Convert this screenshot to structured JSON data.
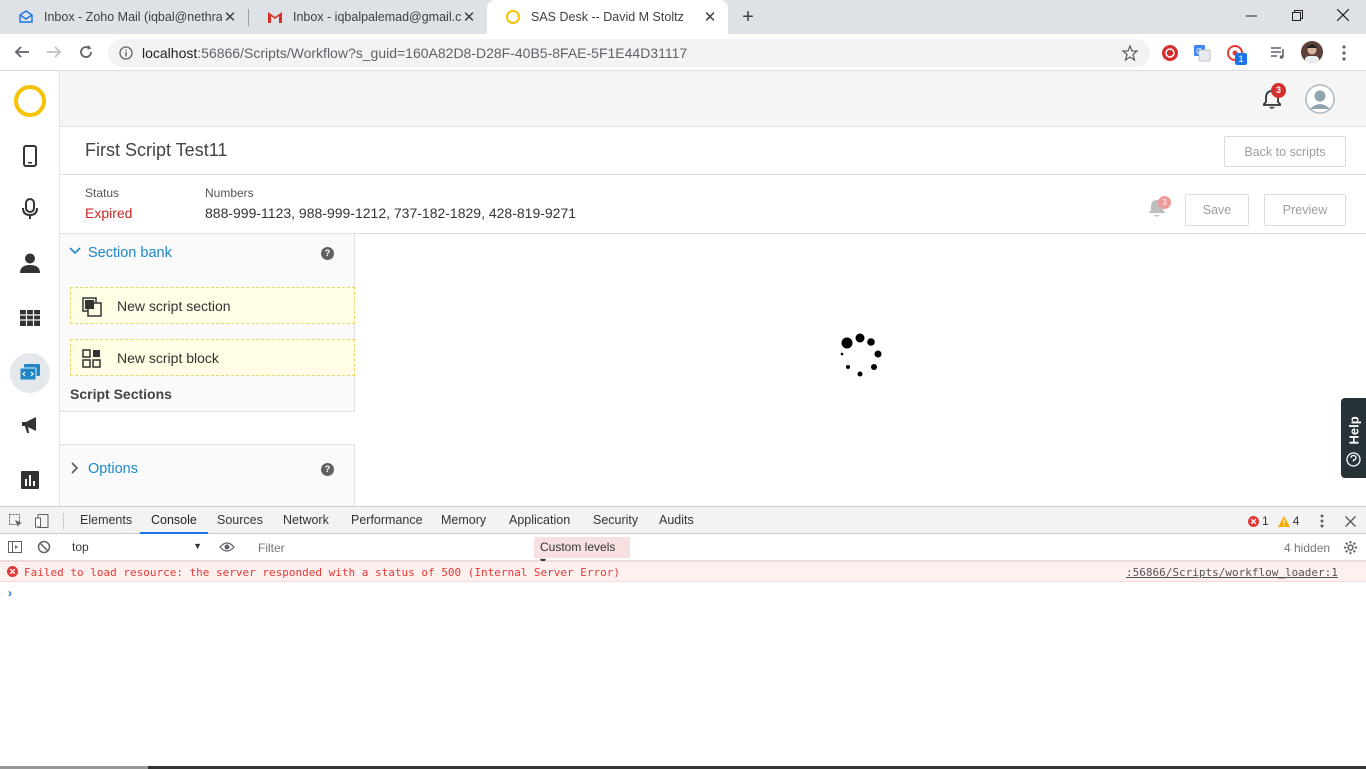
{
  "browser": {
    "tabs": [
      {
        "title": "Inbox - Zoho Mail (iqbal@nethra",
        "icon": "zoho-mail-icon"
      },
      {
        "title": "Inbox - iqbalpalemad@gmail.com",
        "icon": "gmail-icon"
      },
      {
        "title": "SAS Desk -- David M Stoltz",
        "icon": "sas-desk-icon",
        "active": true
      }
    ],
    "url_host": "localhost",
    "url_path": ":56866/Scripts/Workflow?s_guid=160A82D8-D28F-40B5-8FAE-5F1E44D31117",
    "extension_badge": "1"
  },
  "app": {
    "notification_count": "3",
    "page_title": "First Script Test11",
    "back_button": "Back to scripts",
    "status_label": "Status",
    "status_value": "Expired",
    "numbers_label": "Numbers",
    "numbers_value": "888-999-1123, 988-999-1212, 737-182-1829, 428-819-9271",
    "alert_count": "3",
    "save_button": "Save",
    "preview_button": "Preview",
    "section_bank": "Section bank",
    "new_section": "New script section",
    "new_block": "New script block",
    "script_sections": "Script Sections",
    "options": "Options",
    "help_tab": "Help",
    "help_qmark": "?",
    "accent_color": "#1e88c7",
    "status_color": "#c62828"
  },
  "devtools": {
    "tabs": [
      "Elements",
      "Console",
      "Sources",
      "Network",
      "Performance",
      "Memory",
      "Application",
      "Security",
      "Audits"
    ],
    "active_tab": "Console",
    "error_count": "1",
    "warning_count": "4",
    "context": "top",
    "filter_placeholder": "Filter",
    "levels": "Custom levels ▾",
    "hidden": "4 hidden",
    "error_message": "Failed to load resource: the server responded with a status of 500 (Internal Server Error)",
    "error_source": ":56866/Scripts/workflow_loader:1",
    "prompt": "›"
  }
}
